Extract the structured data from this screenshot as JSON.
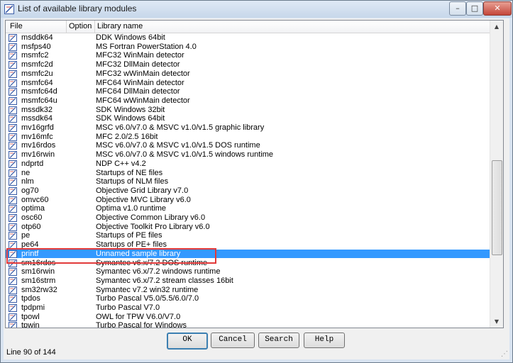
{
  "window": {
    "title": "List of available library modules",
    "controls": {
      "minimize": "–",
      "maximize": "□",
      "close": "✕"
    }
  },
  "list": {
    "headers": {
      "file": "File",
      "option": "Option",
      "library": "Library name"
    },
    "rows": [
      {
        "file": "msddk64",
        "library": "DDK Windows 64bit"
      },
      {
        "file": "msfps40",
        "library": "MS Fortran PowerStation 4.0"
      },
      {
        "file": "msmfc2",
        "library": "MFC32 WinMain detector"
      },
      {
        "file": "msmfc2d",
        "library": "MFC32 DllMain detector"
      },
      {
        "file": "msmfc2u",
        "library": "MFC32 wWinMain detector"
      },
      {
        "file": "msmfc64",
        "library": "MFC64 WinMain detector"
      },
      {
        "file": "msmfc64d",
        "library": "MFC64 DllMain detector"
      },
      {
        "file": "msmfc64u",
        "library": "MFC64 wWinMain detector"
      },
      {
        "file": "mssdk32",
        "library": "SDK Windows 32bit"
      },
      {
        "file": "mssdk64",
        "library": "SDK Windows 64bit"
      },
      {
        "file": "mv16grfd",
        "library": "MSC v6.0/v7.0 & MSVC v1.0/v1.5 graphic library"
      },
      {
        "file": "mv16mfc",
        "library": "MFC 2.0/2.5 16bit"
      },
      {
        "file": "mv16rdos",
        "library": "MSC v6.0/v7.0 & MSVC v1.0/v1.5 DOS runtime"
      },
      {
        "file": "mv16rwin",
        "library": "MSC v6.0/v7.0 & MSVC v1.0/v1.5 windows runtime"
      },
      {
        "file": "ndprtd",
        "library": "NDP C++ v4.2"
      },
      {
        "file": "ne",
        "library": "Startups of NE files"
      },
      {
        "file": "nlm",
        "library": "Startups of NLM files"
      },
      {
        "file": "og70",
        "library": "Objective Grid Library v7.0"
      },
      {
        "file": "omvc60",
        "library": "Objective MVC Library v6.0"
      },
      {
        "file": "optima",
        "library": "Optima v1.0 runtime"
      },
      {
        "file": "osc60",
        "library": "Objective Common Library v6.0"
      },
      {
        "file": "otp60",
        "library": "Objective Toolkit Pro Library v6.0"
      },
      {
        "file": "pe",
        "library": "Startups of PE files"
      },
      {
        "file": "pe64",
        "library": "Startups of PE+ files"
      },
      {
        "file": "printf",
        "library": "Unnamed sample library",
        "selected": true
      },
      {
        "file": "sm16rdos",
        "library": "Symantec v6.x/7.2 DOS runtime"
      },
      {
        "file": "sm16rwin",
        "library": "Symantec v6.x/7.2 windows runtime"
      },
      {
        "file": "sm16strm",
        "library": "Symantec v6.x/7.2 stream classes 16bit"
      },
      {
        "file": "sm32rw32",
        "library": "Symantec v7.2 win32 runtime"
      },
      {
        "file": "tpdos",
        "library": "Turbo Pascal V5.0/5.5/6.0/7.0"
      },
      {
        "file": "tpdpmi",
        "library": "Turbo Pascal V7.0"
      },
      {
        "file": "tpowl",
        "library": "OWL for TPW V6.0/V7.0"
      },
      {
        "file": "tpwin",
        "library": "Turbo Pascal for Windows"
      }
    ]
  },
  "buttons": {
    "ok": "OK",
    "cancel": "Cancel",
    "search": "Search",
    "help": "Help"
  },
  "status": {
    "line": "Line 90 of 144"
  },
  "colors": {
    "selection": "#3399ff",
    "highlight_box": "#e23a3a"
  }
}
